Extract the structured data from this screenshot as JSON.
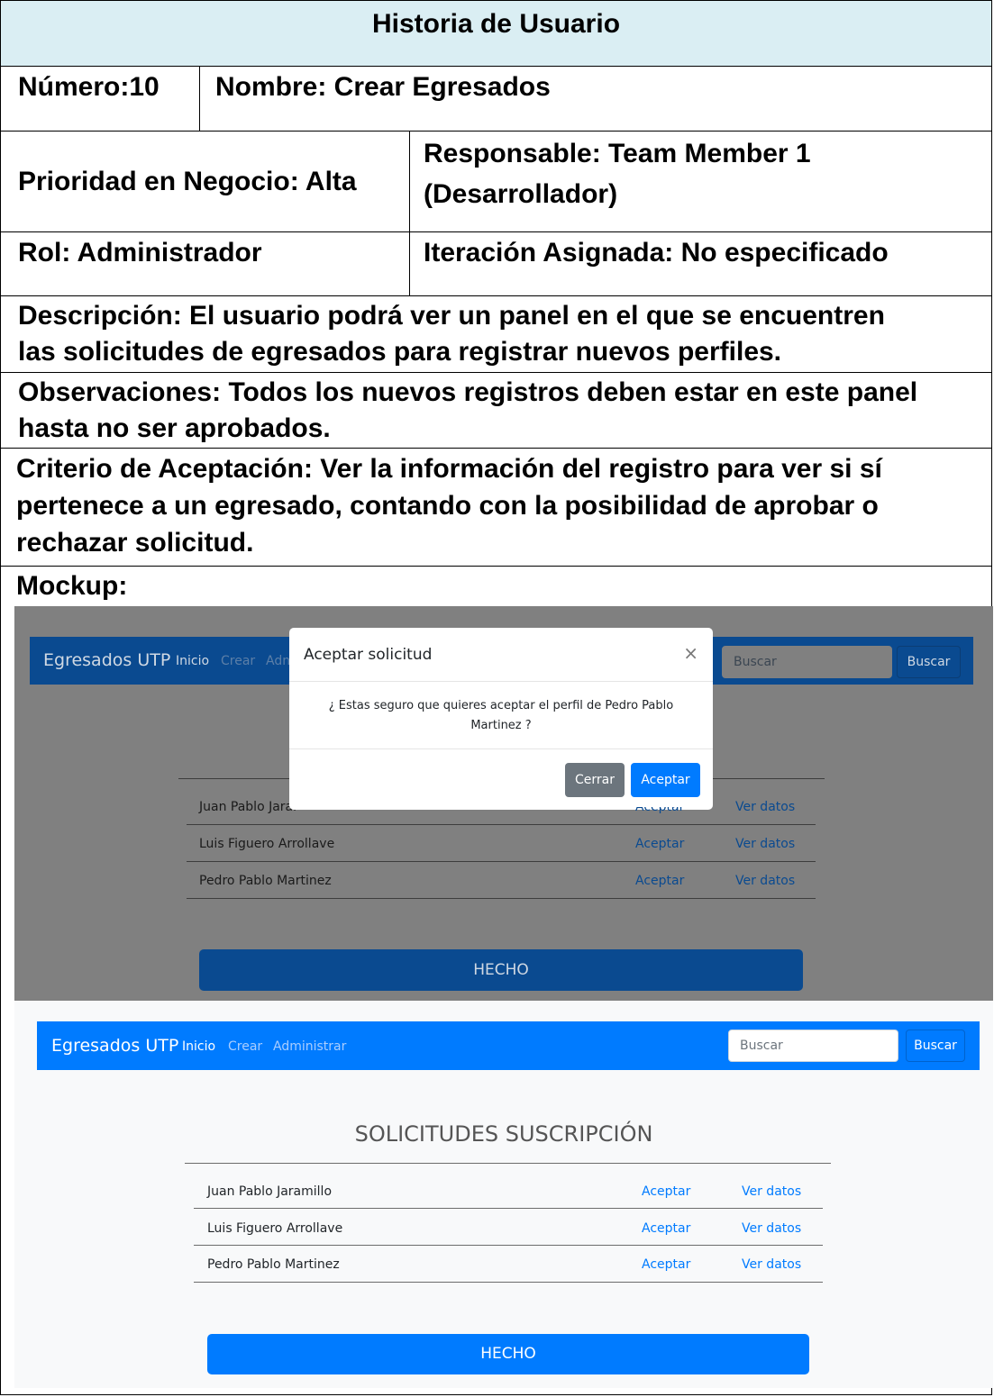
{
  "document": {
    "title": "Historia de Usuario",
    "numero": "Número:10",
    "nombre": "Nombre: Crear Egresados",
    "prioridad": "Prioridad en Negocio: Alta",
    "responsable_line1": "Responsable: Team Member 1",
    "responsable_line2": "(Desarrollador)",
    "rol": "Rol: Administrador",
    "iteracion": "Iteración Asignada: No especificado",
    "descripcion_line1": "Descripción: El usuario podrá ver un panel en el que se encuentren",
    "descripcion_line2": "las solicitudes de egresados para registrar nuevos perfiles.",
    "observaciones_line1": "Observaciones: Todos los nuevos registros deben estar en este panel",
    "observaciones_line2": "hasta no ser aprobados.",
    "criterio_line1": "Criterio de Aceptación: Ver la información del registro para ver si sí",
    "criterio_line2": "pertenece a un egresado, contando con la posibilidad de aprobar o",
    "criterio_line3": "rechazar solicitud.",
    "mockup_label": "Mockup:"
  },
  "mockup": {
    "brand": "Egresados UTP",
    "nav": {
      "inicio": "Inicio",
      "crear": "Crear",
      "administrar": "Administrar",
      "administrar_partial": "Adn"
    },
    "search": {
      "placeholder": "Buscar",
      "button": "Buscar"
    },
    "heading": "SOLICITUDES SUSCRIPCIÓN",
    "accept_label": "Aceptar",
    "view_label": "Ver datos",
    "rows": [
      {
        "name": "Juan Pablo Jaramillo"
      },
      {
        "name": "Luis Figuero Arrollave"
      },
      {
        "name": "Pedro Pablo Martinez"
      }
    ],
    "partial_row_name": "Juan Pablo Jarar",
    "done_button": "HECHO",
    "modal": {
      "title": "Aceptar solicitud",
      "close": "×",
      "body_line1": "¿ Estas seguro que quieres aceptar el perfil de Pedro Pablo",
      "body_line2": "Martinez ?",
      "cancel": "Cerrar",
      "confirm": "Aceptar"
    }
  },
  "colors": {
    "header_bg": "#daeef3",
    "primary": "#007bff",
    "dark_primary": "#0a4a90",
    "overlay": "#808080"
  }
}
